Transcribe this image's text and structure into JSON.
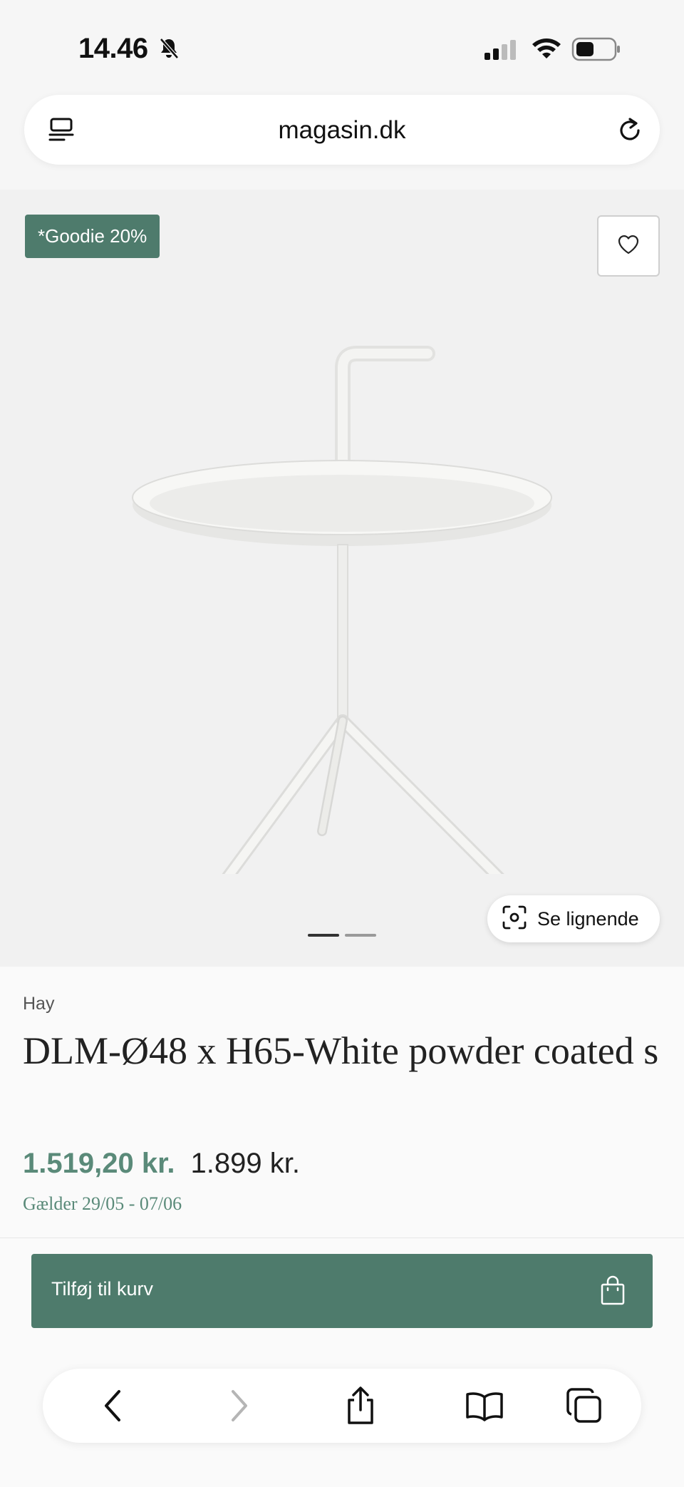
{
  "status_bar": {
    "time": "14.46",
    "icons": [
      "mute-bell-icon",
      "cellular-signal-icon",
      "wifi-icon",
      "battery-icon"
    ]
  },
  "browser": {
    "url": "magasin.dk",
    "icons": [
      "reader-mode-icon",
      "reload-icon"
    ]
  },
  "product": {
    "badge": "*Goodie 20%",
    "brand": "Hay",
    "title": "DLM-Ø48 x H65-White powder coated s",
    "sale_price": "1.519,20 kr.",
    "original_price": "1.899 kr.",
    "validity": "Gælder 29/05 - 07/06",
    "image_count": 2,
    "active_image": 1
  },
  "actions": {
    "similar_label": "Se lignende",
    "add_to_cart_label": "Tilføj til kurv"
  },
  "toolbar": {
    "icons": [
      "back-icon",
      "forward-icon",
      "share-icon",
      "bookmarks-icon",
      "tabs-icon"
    ]
  },
  "colors": {
    "accent": "#4e7b6c",
    "sale_price": "#5a8a79",
    "image_bg": "#f1f1f1"
  }
}
